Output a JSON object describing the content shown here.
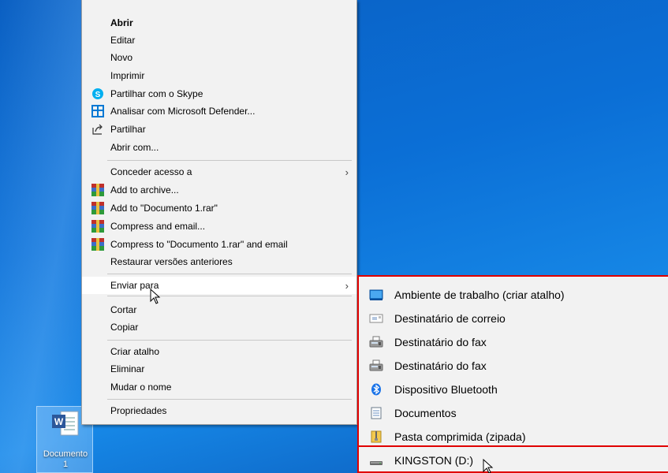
{
  "context_menu": {
    "items": [
      {
        "label": "Abrir",
        "bold": true,
        "icon": ""
      },
      {
        "label": "Editar",
        "icon": ""
      },
      {
        "label": "Novo",
        "icon": ""
      },
      {
        "label": "Imprimir",
        "icon": ""
      },
      {
        "label": "Partilhar com o Skype",
        "icon": "skype-icon"
      },
      {
        "label": "Analisar com Microsoft Defender...",
        "icon": "defender-icon"
      },
      {
        "label": "Partilhar",
        "icon": "share-icon"
      },
      {
        "label": "Abrir com...",
        "icon": ""
      },
      {
        "label": "Conceder acesso a",
        "icon": "",
        "submenu": true
      },
      {
        "label": "Add to archive...",
        "icon": "winrar-icon"
      },
      {
        "label": "Add to \"Documento 1.rar\"",
        "icon": "winrar-icon"
      },
      {
        "label": "Compress and email...",
        "icon": "winrar-icon"
      },
      {
        "label": "Compress to \"Documento 1.rar\" and email",
        "icon": "winrar-icon"
      },
      {
        "label": "Restaurar versões anteriores",
        "icon": ""
      },
      {
        "label": "Enviar para",
        "icon": "",
        "submenu": true,
        "highlighted": true
      },
      {
        "label": "Cortar",
        "icon": ""
      },
      {
        "label": "Copiar",
        "icon": ""
      },
      {
        "label": "Criar atalho",
        "icon": ""
      },
      {
        "label": "Eliminar",
        "icon": ""
      },
      {
        "label": "Mudar o nome",
        "icon": ""
      },
      {
        "label": "Propriedades",
        "icon": ""
      }
    ],
    "arrow_glyph": "›"
  },
  "send_to_menu": {
    "items": [
      {
        "label": "Ambiente de trabalho (criar atalho)",
        "icon": "desktop-icon"
      },
      {
        "label": "Destinatário de correio",
        "icon": "mail-recipient-icon"
      },
      {
        "label": "Destinatário do fax",
        "icon": "fax-icon"
      },
      {
        "label": "Destinatário do fax",
        "icon": "fax-icon"
      },
      {
        "label": "Dispositivo Bluetooth",
        "icon": "bluetooth-icon"
      },
      {
        "label": "Documentos",
        "icon": "documents-icon"
      },
      {
        "label": "Pasta comprimida (zipada)",
        "icon": "zip-folder-icon"
      },
      {
        "label": "KINGSTON (D:)",
        "icon": "drive-icon"
      }
    ],
    "highlight_color": "#e00000"
  },
  "desktop": {
    "file_icon": {
      "name_line1": "Documento",
      "name_line2": "1",
      "icon": "word-document-icon"
    }
  },
  "colors": {
    "menu_bg": "#f2f2f2",
    "desktop_blue": "#0b6fd6",
    "skype": "#00aff0",
    "defender": "#0078d4",
    "winrar_red": "#c0302a",
    "word_blue": "#2b579a"
  }
}
